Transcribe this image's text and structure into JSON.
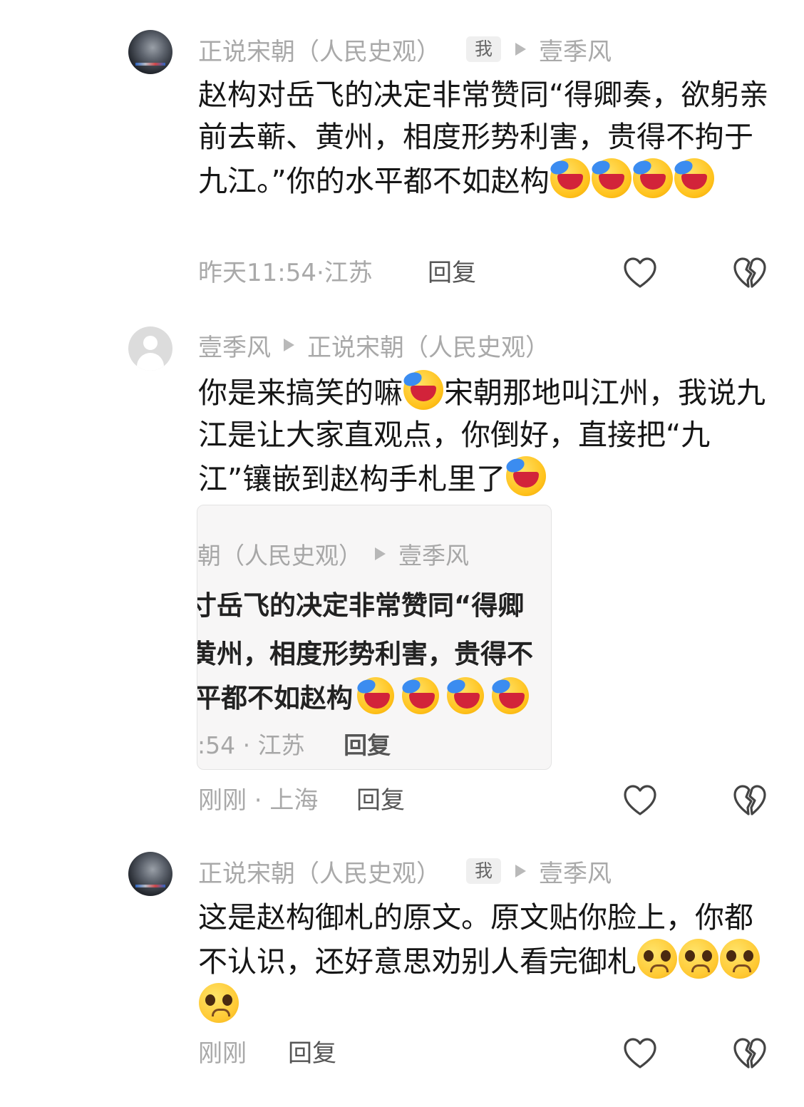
{
  "comments": [
    {
      "author": "正说宋朝（人民史观）",
      "badge": "我",
      "reply_to": "壹季风",
      "text": "赵构对岳飞的决定非常赞同“得卿奏，欲躬亲前去蕲、黄州，相度形势利害，贵得不拘于九江。”你的水平都不如赵构",
      "time": "昨天11:54·江苏",
      "reply_label": "回复"
    },
    {
      "author": "壹季风",
      "reply_to": "正说宋朝（人民史观）",
      "text_a": "你是来搞笑的嘛",
      "text_b": "宋朝那地叫江州，我说九江是让大家直观点，你倒好，直接把“九江”镶嵌到赵构手札里了",
      "quote": {
        "meta_author": "朝（人民史观）",
        "meta_reply_to": "壹季风",
        "line1": "寸岳飞的决定非常赞同“得卿",
        "line2": "黄州，相度形势利害，贵得不",
        "line3": "平都不如赵构",
        "time": ":54 · 江苏",
        "reply_label": "回复"
      },
      "time": "刚刚 · 上海",
      "reply_label": "回复"
    },
    {
      "author": "正说宋朝（人民史观）",
      "badge": "我",
      "reply_to": "壹季风",
      "text": "这是赵构御札的原文。原文贴你脸上，你都不认识，还好意思劝别人看完御札",
      "time": "刚刚",
      "reply_label": "回复"
    }
  ],
  "icons": {
    "like": "heart-outline-icon",
    "dislike": "broken-heart-icon",
    "emoji_laugh": "laughing-crying-emoji",
    "emoji_plead": "pleading-face-emoji"
  },
  "colors": {
    "meta_gray": "#a9a9a9",
    "text": "#161616",
    "reply": "#555555"
  }
}
